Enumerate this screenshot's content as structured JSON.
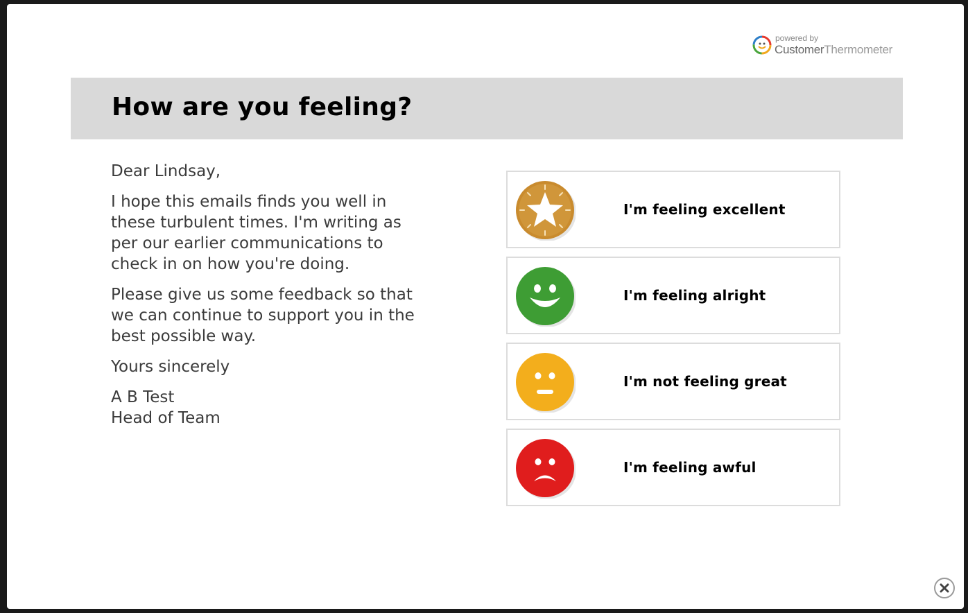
{
  "brand": {
    "powered_by": "powered by",
    "name_part1": "Customer",
    "name_part2": "Thermometer"
  },
  "survey": {
    "title": "How are you feeling?"
  },
  "letter": {
    "greeting": "Dear Lindsay,",
    "paragraph1": "I hope this emails finds you well in\nthese turbulent times. I'm writing as\nper our earlier communications to\ncheck in on how you're doing.",
    "paragraph2": "Please give us some feedback so that\nwe can continue to support you in the\nbest possible way.",
    "closing": "Yours sincerely",
    "signature_name": "A B Test",
    "signature_title": "Head of Team"
  },
  "options": [
    {
      "label": "I'm feeling excellent",
      "icon": "star-medal-icon",
      "color": "#c98b2e"
    },
    {
      "label": "I'm feeling alright",
      "icon": "happy-face-icon",
      "color": "#3e9d34"
    },
    {
      "label": "I'm not feeling great",
      "icon": "neutral-face-icon",
      "color": "#f3ae1c"
    },
    {
      "label": "I'm feeling awful",
      "icon": "sad-face-icon",
      "color": "#e01d1d"
    }
  ],
  "close": {
    "icon": "close-icon"
  }
}
